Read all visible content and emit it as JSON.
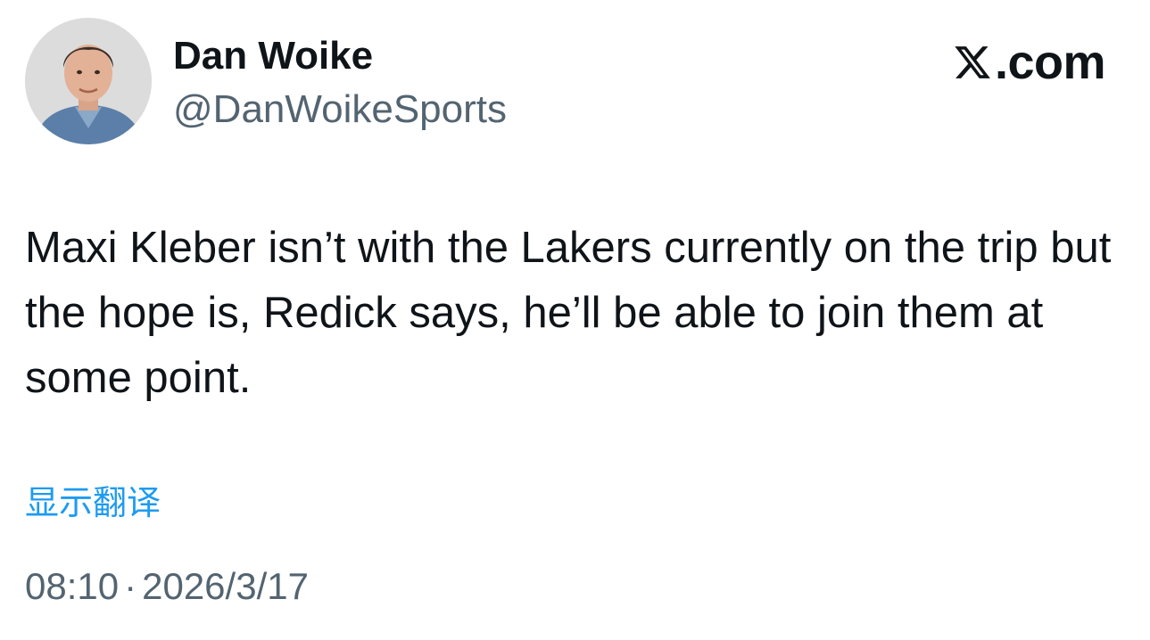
{
  "author": {
    "display_name": "Dan Woike",
    "handle": "@DanWoikeSports",
    "avatar_icon": "profile-photo"
  },
  "brand": {
    "logo_icon": "x-logo-icon",
    "text": ".com"
  },
  "tweet": {
    "text": "Maxi Kleber isn’t with the Lakers currently on the trip but the hope is, Redick says, he’ll be able to join them at some point.",
    "translate_label": "显示翻译"
  },
  "meta": {
    "time": "08:10",
    "separator": "·",
    "date": "2026/3/17"
  },
  "colors": {
    "text_primary": "#0f1419",
    "text_secondary": "#536471",
    "link": "#1d9bf0",
    "background": "#ffffff"
  }
}
